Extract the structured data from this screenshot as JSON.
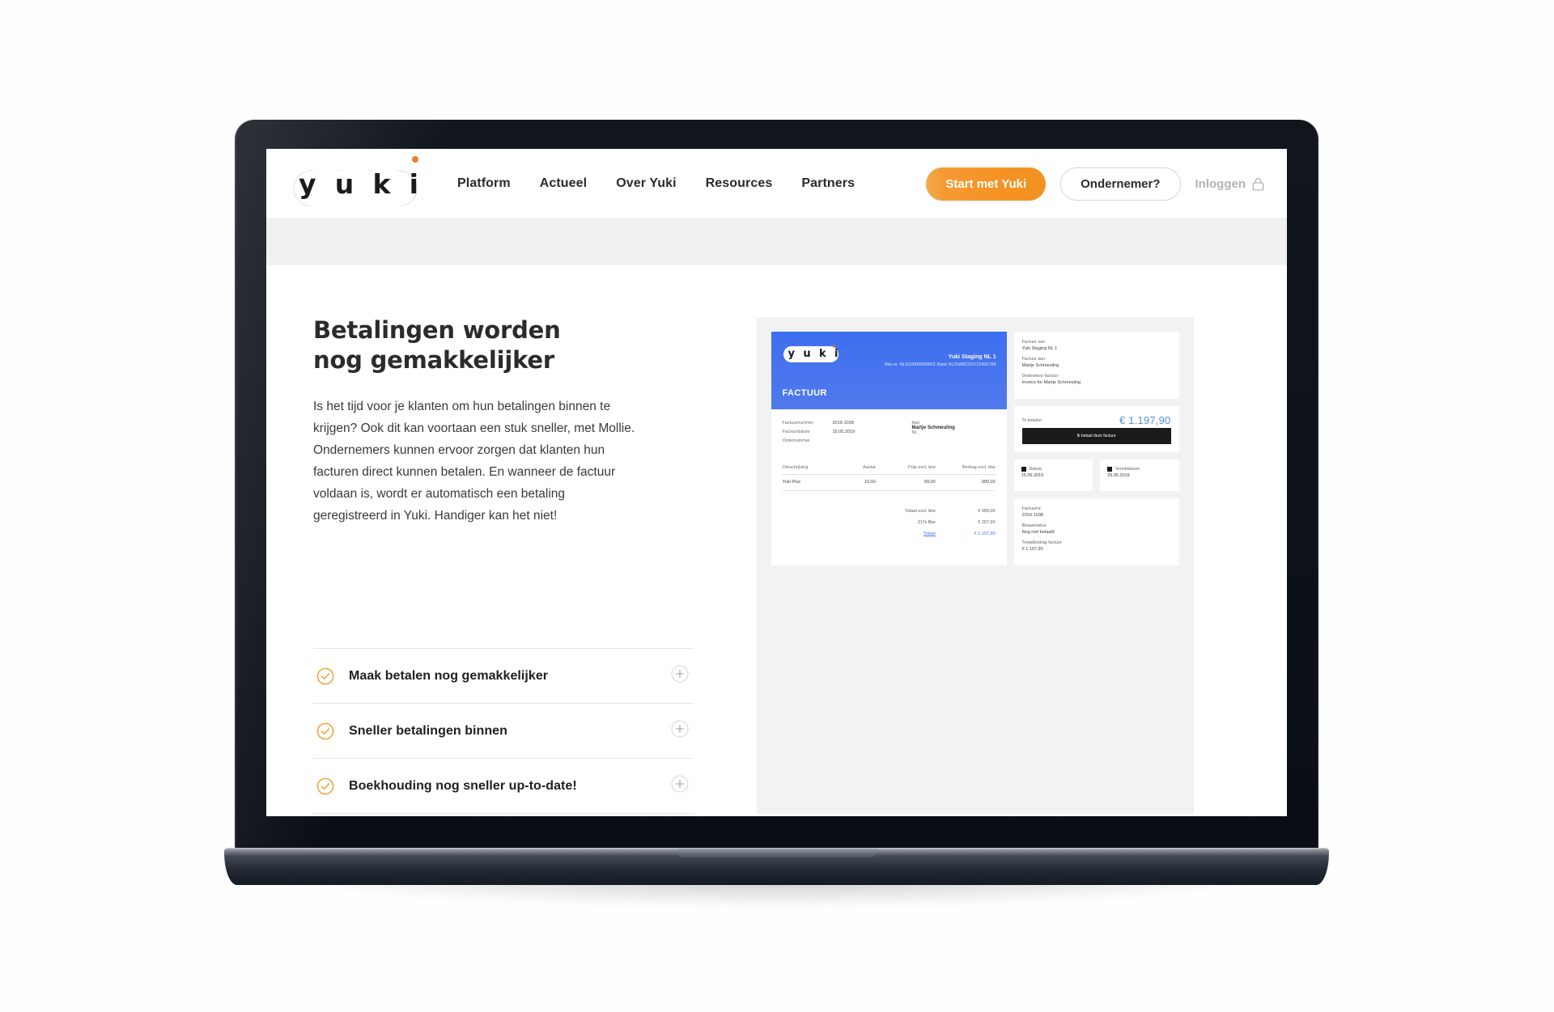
{
  "brand": {
    "logo_letters": [
      "y",
      "u",
      "k",
      "i"
    ],
    "accent_orange": "#f5931f",
    "accent_blue": "#3e6ff0"
  },
  "header": {
    "nav": [
      {
        "label": "Platform"
      },
      {
        "label": "Actueel"
      },
      {
        "label": "Over Yuki"
      },
      {
        "label": "Resources"
      },
      {
        "label": "Partners"
      }
    ],
    "cta_primary": "Start met Yuki",
    "cta_secondary": "Ondernemer?",
    "login_label": "Inloggen"
  },
  "main": {
    "headline": "Betalingen worden nog gemakkelijker",
    "paragraph": "Is het tijd voor je klanten om hun betalingen binnen te krijgen? Ook dit kan voortaan een stuk sneller, met Mollie. Ondernemers kunnen ervoor zorgen dat klanten hun facturen direct kunnen betalen. En wanneer de factuur voldaan is, wordt er automatisch een betaling geregistreerd in Yuki. Handiger kan het niet!"
  },
  "accordion": [
    {
      "title": "Maak betalen nog gemakkelijker",
      "expand": "+"
    },
    {
      "title": "Sneller betalingen binnen",
      "expand": "+"
    },
    {
      "title": "Boekhouding nog sneller up-to-date!",
      "expand": "+"
    }
  ],
  "invoice": {
    "title": "FACTUUR",
    "company_name": "Yuki Staging NL 1",
    "company_lines": "Btw-nr.  NL810000000B01\nBank  NL00ABCD0123456789",
    "meta": [
      {
        "key": "Factuurnummer",
        "value": "2019-1038"
      },
      {
        "key": "Factuurdatum",
        "value": "15.05.2019"
      },
      {
        "key": "Ordernummer",
        "value": ""
      }
    ],
    "recipient_label": "Aan",
    "recipient_name": "Martje Schmeuling",
    "recipient_country": "NL",
    "table_headers": [
      "Omschrijving",
      "Aantal",
      "Prijs excl. btw",
      "Bedrag excl. btw"
    ],
    "table_rows": [
      {
        "omschrijving": "Yuki Plus",
        "aantal": "10,00",
        "prijs": "99,00",
        "bedrag": "990,00"
      }
    ],
    "totals": [
      {
        "label": "Totaal excl. btw",
        "value": "€ 990,00"
      },
      {
        "label": "21% Btw",
        "value": "€ 207,90"
      },
      {
        "label": "Totaal",
        "value": "€ 1.197,90"
      }
    ],
    "side": {
      "from_label": "Factuur van",
      "from_value": "Yuki Staging NL 1",
      "to_label": "Factuur aan",
      "to_value": "Martje Schmeuling",
      "subject_label": "Onderwerp factuur",
      "subject_value": "Invoice for Martje Schmeuling",
      "total_label": "Te betalen",
      "total_amount": "€ 1.197,90",
      "pay_button": "Ik betaal deze factuur",
      "issued_label": "Datum",
      "issued_value": "15.05.2019",
      "due_label": "Vervaldatum",
      "due_value": "29.05.2019",
      "invoice_no_label": "Factuurnr.",
      "invoice_no_value": "2019-1038",
      "status_label": "Betaalstatus",
      "status_value": "Nog niet betaald",
      "grand_label": "Totaalbedrag factuur",
      "grand_value": "€ 1.197,90"
    }
  },
  "icons": {
    "lock": "lock-icon",
    "check_circle": "check-circle-icon",
    "plus_circle": "plus-circle-icon"
  }
}
